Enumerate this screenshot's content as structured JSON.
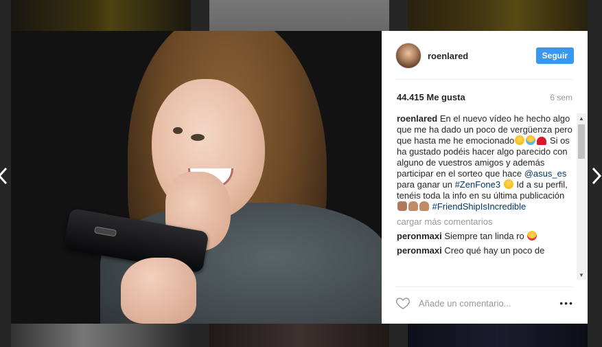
{
  "post": {
    "username": "roenlared",
    "follow_label": "Seguir",
    "likes": "44.415 Me gusta",
    "age": "6 sem",
    "caption": {
      "user": "roenlared",
      "text_1": "En el nuevo vídeo he hecho algo que me ha dado un poco de vergüenza pero que hasta me he emocionado",
      "text_2": " Si os ha gustado podéis hacer algo parecido con alguno de vuestros amigos y además participar en el sorteo que hace ",
      "mention": "@asus_es",
      "text_3": " para ganar un ",
      "hashtag_1": "#ZenFone3",
      "text_4": " Id a su perfil, tenéis toda la info en su última publicación ",
      "hashtag_2": "#FriendShipIsIncredible"
    },
    "load_more": "cargar más comentarios",
    "comments": [
      {
        "user": "peronmaxi",
        "text": "Siempre tan linda ro "
      },
      {
        "user": "peronmaxi",
        "text": "Creo qué hay un poco de"
      }
    ],
    "comment_placeholder": "Añade un comentario...",
    "more_options": "•••"
  },
  "icons": {
    "nav_left": "chevron-left-icon",
    "nav_right": "chevron-right-icon",
    "like": "heart-outline-icon",
    "more": "more-options-icon"
  },
  "colors": {
    "follow_button": "#3897f0",
    "link": "#003569",
    "overlay": "#262626"
  }
}
